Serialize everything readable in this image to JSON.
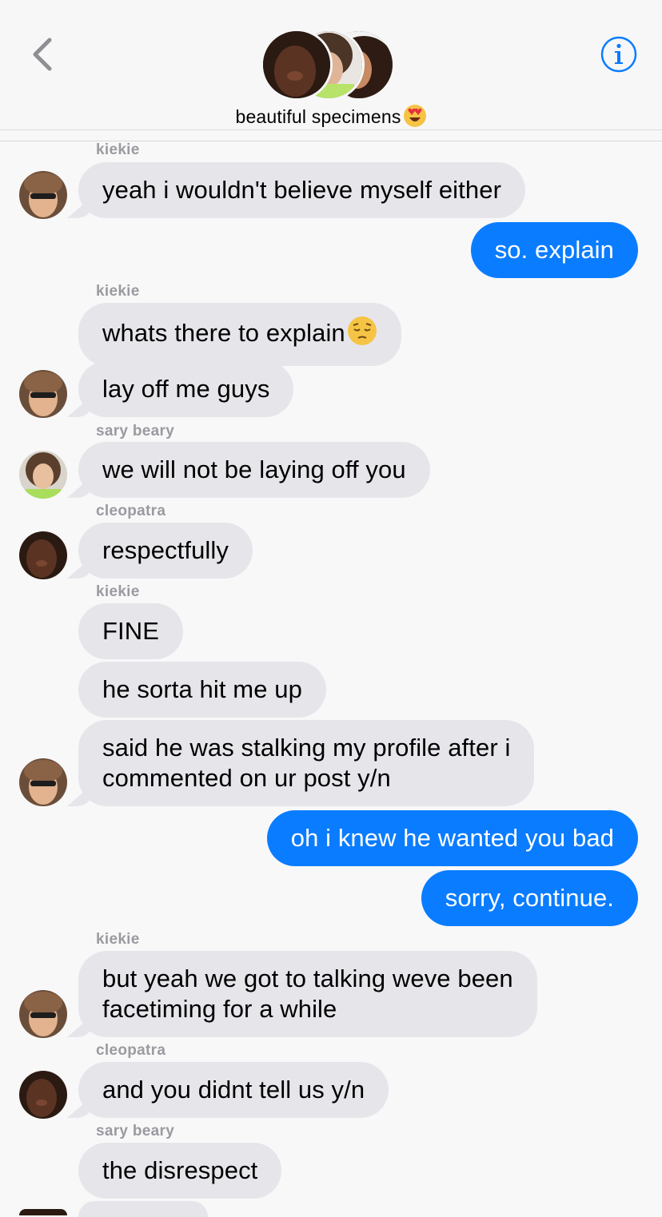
{
  "header": {
    "title": "beautiful specimens",
    "title_emoji": "heart-eyes-emoji",
    "back_icon": "chevron-left-icon",
    "info_icon": "info-icon",
    "accent_color": "#0a7cff"
  },
  "messages": [
    {
      "sender": "kiekie",
      "text": "yeah i wouldn't believe myself either",
      "dir": "in"
    },
    {
      "text": "so. explain",
      "dir": "out"
    },
    {
      "sender": "kiekie",
      "text": "whats there to explain",
      "emoji": "pensive-face-emoji",
      "dir": "in"
    },
    {
      "text": "lay off me guys",
      "dir": "in"
    },
    {
      "sender": "sary beary",
      "text": "we will not be laying off you",
      "dir": "in"
    },
    {
      "sender": "cleopatra",
      "text": "respectfully",
      "dir": "in"
    },
    {
      "sender": "kiekie",
      "text": "FINE",
      "dir": "in"
    },
    {
      "text": "he sorta hit me up",
      "dir": "in"
    },
    {
      "text": "said he was stalking my profile after i",
      "text2": "commented on ur post y/n",
      "dir": "in"
    },
    {
      "text": "oh i knew he wanted you bad",
      "dir": "out"
    },
    {
      "text": "sorry, continue.",
      "dir": "out"
    },
    {
      "sender": "kiekie",
      "text": "but yeah we got to talking weve been",
      "text2": "facetiming for a while",
      "dir": "in"
    },
    {
      "sender": "cleopatra",
      "text": "and you didnt tell us y/n",
      "dir": "in"
    },
    {
      "sender": "sary beary",
      "text": "the disrespect",
      "dir": "in"
    }
  ],
  "colors": {
    "incoming_bubble": "#e6e5ea",
    "outgoing_bubble": "#0a7cff",
    "sender_label": "#9a9aa0"
  }
}
